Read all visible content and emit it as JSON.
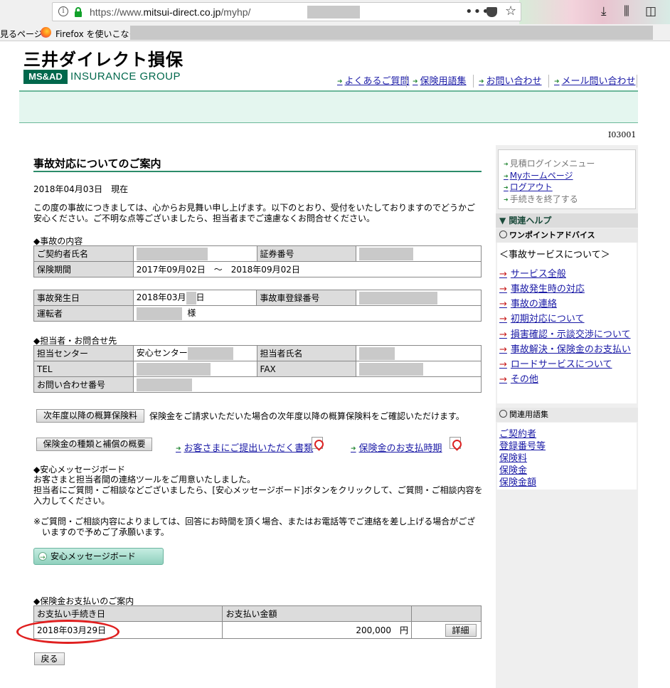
{
  "browser": {
    "url_prefix": "https://www.",
    "url_domain": "mitsui-direct.co.jp",
    "url_path": "/myhp/",
    "more_glyph": "•••",
    "star_glyph": "☆",
    "bookmark_1": "見るページ",
    "bookmark_2": "Firefox を使いこなそう"
  },
  "site": {
    "logo": "三井ダイレクト損保",
    "group_badge": "MS&AD",
    "group_name": "INSURANCE GROUP",
    "nav": [
      "よくあるご質問",
      "保険用語集",
      "お問い合わせ",
      "メール問い合わせ"
    ],
    "page_id": "I03001"
  },
  "main": {
    "title": "事故対応についてのご案内",
    "date_line": "2018年04月03日　現在",
    "intro": "この度の事故につきましては、心からお見舞い申し上げます。以下のとおり、受付をいたしておりますのでどうかご安心ください。ご不明な点等ございましたら、担当者までご遠慮なくお問合せください。",
    "sec_accident": "◆事故の内容",
    "contract": {
      "holder_label": "ご契約者氏名",
      "policy_label": "証券番号",
      "period_label": "保険期間",
      "period_value": "2017年09月02日　～　2018年09月02日"
    },
    "accident": {
      "date_label": "事故発生日",
      "date_pre": "2018年03月",
      "date_post": "日",
      "car_label": "事故車登録番号",
      "driver_label": "運転者",
      "driver_suffix": "様"
    },
    "sec_contact": "◆担当者・お問合せ先",
    "contact": {
      "center_label": "担当センター",
      "center_value": "安心センター",
      "person_label": "担当者氏名",
      "tel_label": "TEL",
      "fax_label": "FAX",
      "inquiry_label": "お問い合わせ番号"
    },
    "premium_button": "次年度以降の概算保険料",
    "premium_desc": "保険金をご請求いただいた場合の次年度以降の概算保険料をご確認いただけます。",
    "coverage_button": "保険金の種類と補償の概要",
    "docs_link": "お客さまにご提出いただく書類",
    "timing_link": "保険金のお支払時期",
    "sec_board": "◆安心メッセージボード",
    "board_text": "お客さまと担当者間の連絡ツールをご用意いたしました。\n担当者にご質問・ご相談などございましたら、[安心メッセージボード]ボタンをクリックして、ご質問・ご相談内容を入力してください。",
    "board_note": "※ご質問・ご相談内容によりましては、回答にお時間を頂く場合、またはお電話等でご連絡を差し上げる場合がございますので予めご了承願います。",
    "board_button": "安心メッセージボード",
    "sec_payment": "◆保険金お支払いのご案内",
    "payment": {
      "col_date": "お支払い手続き日",
      "col_amount": "お支払い金額",
      "row_date": "2018年03月29日",
      "row_amount": "200,000　円",
      "detail_button": "詳細"
    },
    "back_button": "戻る"
  },
  "sidebar": {
    "login_links": [
      "見積ログインメニュー",
      "Myホームページ",
      "ログアウト",
      "手続きを終了する"
    ],
    "help_head": "▼ 関連ヘルプ",
    "advice_head": "ワンポイントアドバイス",
    "advice_topic": "＜事故サービスについて＞",
    "help_items": [
      "サービス全般",
      "事故発生時の対応",
      "事故の連絡",
      "初期対応について",
      "損害確認・示談交渉について",
      "事故解決・保険金のお支払い",
      "ロードサービスについて",
      "その他"
    ],
    "terms_head": "関連用語集",
    "terms": [
      "ご契約者",
      "登録番号等",
      "保険料",
      "保険金",
      "保険金額"
    ]
  }
}
